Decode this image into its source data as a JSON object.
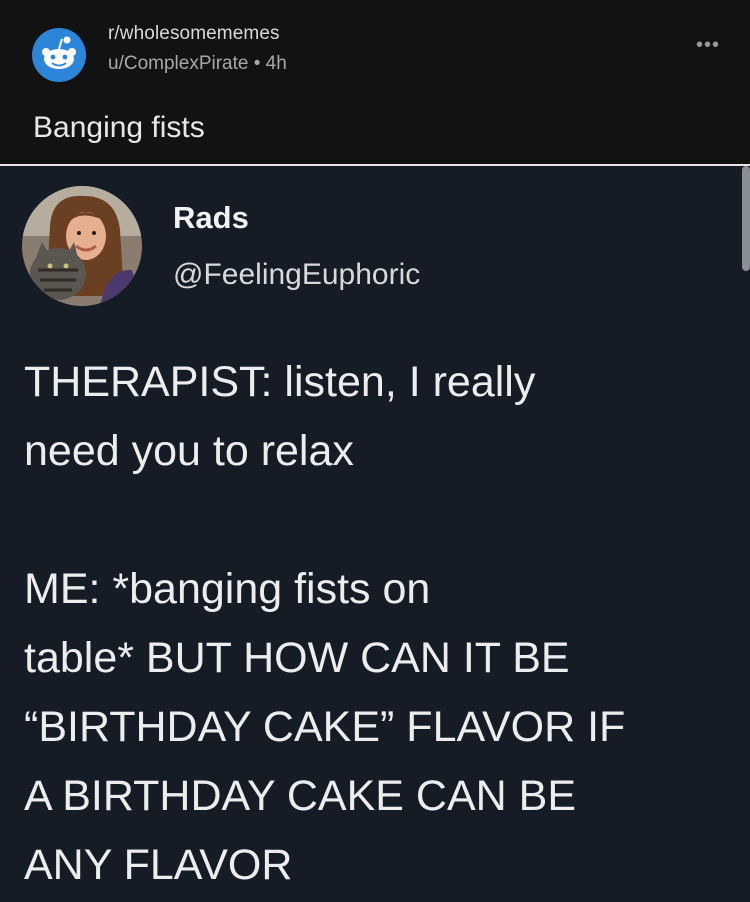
{
  "post": {
    "subreddit": "r/wholesomememes",
    "author": "u/ComplexPirate",
    "separator": "•",
    "age": "4h",
    "title": "Banging fists"
  },
  "tweet": {
    "display_name": "Rads",
    "handle": "@FeelingEuphoric",
    "paragraph1": "THERAPIST: listen, I really\nneed you to relax",
    "paragraph2": "ME: *banging fists on\ntable* BUT HOW CAN IT BE\n“BIRTHDAY CAKE” FLAVOR IF\nA BIRTHDAY CAKE CAN BE\nANY FLAVOR"
  },
  "icons": {
    "subreddit": "reddit-snoo-icon",
    "more": "more-options-icon",
    "avatar": "profile-avatar"
  },
  "colors": {
    "reddit_blue": "#2b86d9",
    "tweet_background": "#151c25",
    "header_background": "#121212"
  }
}
